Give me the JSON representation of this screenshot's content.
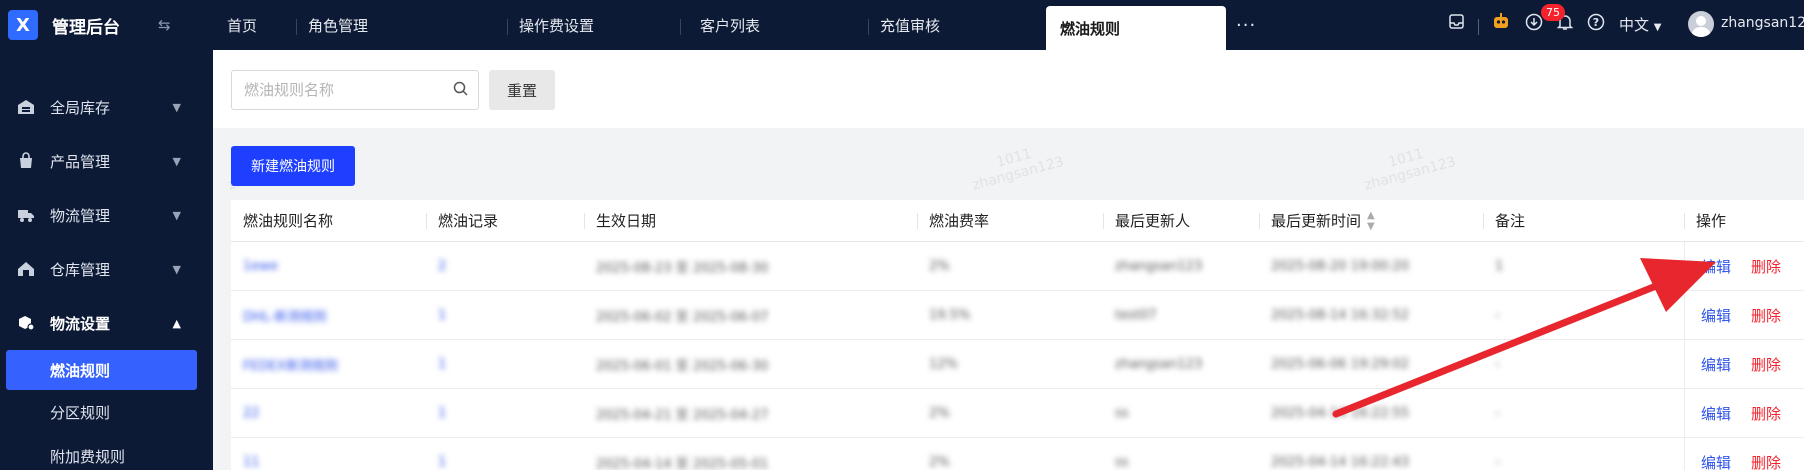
{
  "app": {
    "logo": "X",
    "title": "管理后台"
  },
  "sidebar": {
    "items": [
      {
        "icon": "warehouse-icon",
        "label": "全局库存",
        "open": false
      },
      {
        "icon": "bag-icon",
        "label": "产品管理",
        "open": false
      },
      {
        "icon": "truck-icon",
        "label": "物流管理",
        "open": false
      },
      {
        "icon": "house-icon",
        "label": "仓库管理",
        "open": false
      },
      {
        "icon": "box-settings-icon",
        "label": "物流设置",
        "open": true
      }
    ],
    "sub_items": [
      {
        "label": "燃油规则",
        "active": true
      },
      {
        "label": "分区规则",
        "active": false
      },
      {
        "label": "附加费规则",
        "active": false
      }
    ]
  },
  "tabs": [
    {
      "label": "首页",
      "active": false
    },
    {
      "label": "角色管理",
      "active": false
    },
    {
      "label": "操作费设置",
      "active": false
    },
    {
      "label": "客户列表",
      "active": false
    },
    {
      "label": "充值审核",
      "active": false
    },
    {
      "label": "燃油规则",
      "active": true
    }
  ],
  "header": {
    "more": "···",
    "notification_count": "75",
    "language": "中文",
    "username": "zhangsan12"
  },
  "filter": {
    "search_placeholder": "燃油规则名称",
    "reset_label": "重置"
  },
  "new_button": "新建燃油规则",
  "watermark": {
    "line1": "1011",
    "line2": "zhangsan123"
  },
  "table": {
    "columns": [
      "燃油规则名称",
      "燃油记录",
      "生效日期",
      "燃油费率",
      "最后更新人",
      "最后更新时间",
      "备注",
      "操作"
    ],
    "rows": [
      {
        "name": "1ewe",
        "records": "2",
        "dates": "2025-08-23  至  2025-08-30",
        "rate": "2%",
        "updater": "zhangsan123",
        "updated": "2025-08-20 19:00:20",
        "note": "1"
      },
      {
        "name": "DHL-新测规则",
        "records": "1",
        "dates": "2025-06-02  至  2025-06-07",
        "rate": "19.5%",
        "updater": "test07",
        "updated": "2025-08-14 16:32:52",
        "note": "-"
      },
      {
        "name": "FEDEX新测规则",
        "records": "1",
        "dates": "2025-06-01  至  2025-06-30",
        "rate": "12%",
        "updater": "zhangsan123",
        "updated": "2025-06-06 19:29:02",
        "note": "-"
      },
      {
        "name": "22",
        "records": "1",
        "dates": "2025-04-21  至  2025-04-27",
        "rate": "2%",
        "updater": "ss",
        "updated": "2025-04-14 16:22:55",
        "note": "-"
      },
      {
        "name": "11",
        "records": "1",
        "dates": "2025-04-14  至  2025-05-01",
        "rate": "2%",
        "updater": "ss",
        "updated": "2025-04-14 16:22:43",
        "note": "-"
      }
    ],
    "edit_label": "编辑",
    "delete_label": "删除"
  },
  "colors": {
    "accent": "#1e3fff",
    "sidebar_bg": "#0d1a35",
    "danger": "#f5222d",
    "annotation_arrow": "#e8262d"
  }
}
